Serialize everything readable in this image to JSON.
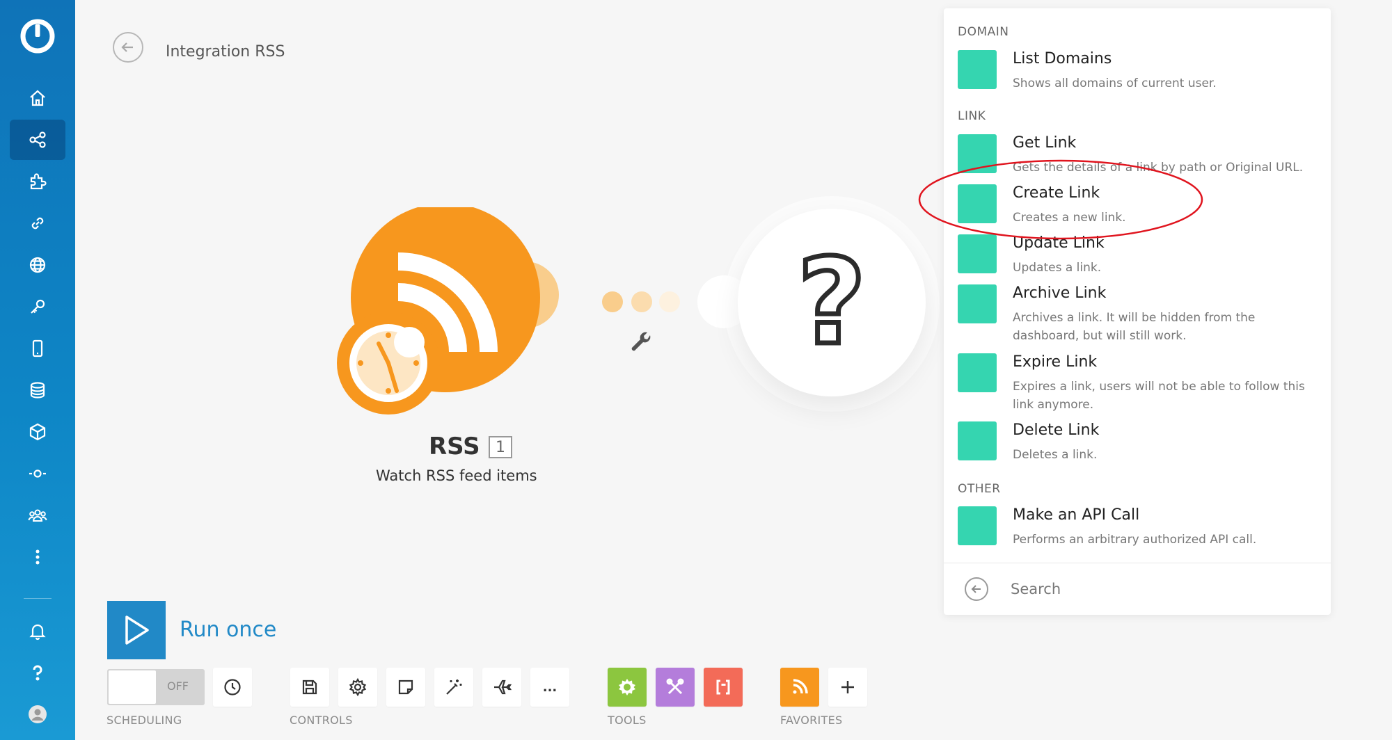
{
  "header": {
    "title": "Integration RSS"
  },
  "sidebar": {
    "items": [
      {
        "name": "home-icon"
      },
      {
        "name": "scenarios-icon"
      },
      {
        "name": "apps-icon"
      },
      {
        "name": "connections-icon"
      },
      {
        "name": "webhooks-icon"
      },
      {
        "name": "keys-icon"
      },
      {
        "name": "devices-icon"
      },
      {
        "name": "data-stores-icon"
      },
      {
        "name": "data-structures-icon"
      },
      {
        "name": "flow-control-icon"
      },
      {
        "name": "team-icon"
      },
      {
        "name": "more-icon"
      },
      {
        "name": "notifications-icon"
      },
      {
        "name": "help-icon"
      },
      {
        "name": "avatar-icon"
      }
    ]
  },
  "canvas": {
    "rss_module": {
      "name": "RSS",
      "badge": "1",
      "description": "Watch RSS feed items",
      "color": "#f7971e"
    },
    "next_module": {
      "symbol": "?"
    }
  },
  "panel": {
    "groups": [
      {
        "header": "DOMAIN",
        "actions": [
          {
            "title": "List Domains",
            "desc": "Shows all domains of current user."
          }
        ]
      },
      {
        "header": "LINK",
        "actions": [
          {
            "title": "Get Link",
            "desc": "Gets the details of a link by path or Original URL."
          },
          {
            "title": "Create Link",
            "desc": "Creates a new link."
          },
          {
            "title": "Update Link",
            "desc": "Updates a link."
          },
          {
            "title": "Archive Link",
            "desc": "Archives a link. It will be hidden from the dashboard, but will still work."
          },
          {
            "title": "Expire Link",
            "desc": "Expires a link, users will not be able to follow this link anymore."
          },
          {
            "title": "Delete Link",
            "desc": "Deletes a link."
          }
        ]
      },
      {
        "header": "OTHER",
        "actions": [
          {
            "title": "Make an API Call",
            "desc": "Performs an arbitrary authorized API call."
          }
        ]
      }
    ],
    "search_placeholder": "Search",
    "action_color": "#35d5b0",
    "highlighted_action": "Create Link",
    "highlight_color": "#e0141e"
  },
  "toolbar": {
    "run_once_label": "Run once",
    "toggle_state": "OFF",
    "sections": {
      "scheduling": "SCHEDULING",
      "controls": "CONTROLS",
      "tools": "TOOLS",
      "favorites": "FAVORITES"
    },
    "controls_more": "..."
  }
}
